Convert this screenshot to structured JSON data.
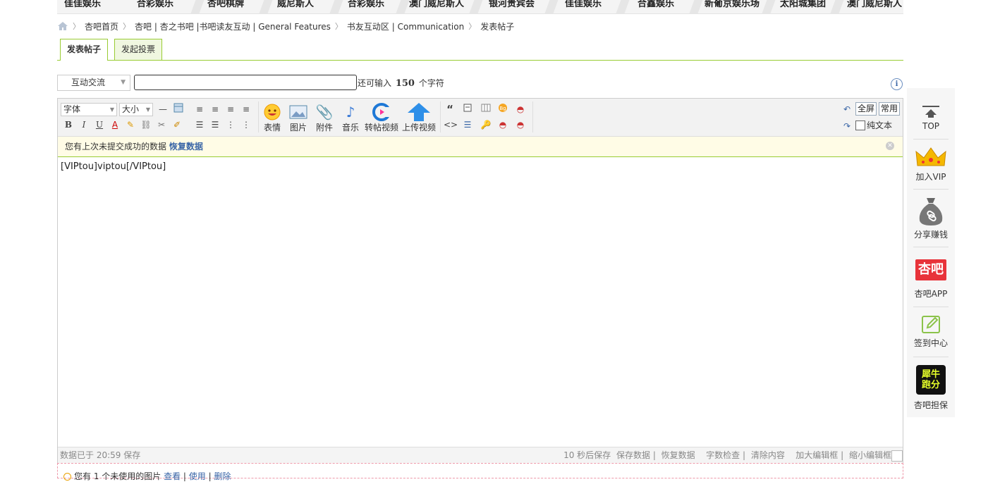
{
  "top_nav": [
    "佳佳娱乐",
    "合彩娱乐",
    "杏吧棋牌",
    "威尼斯人",
    "合彩娱乐",
    "澳门威尼斯人",
    "银河贵宾会",
    "佳佳娱乐",
    "合鑫娱乐",
    "新葡京娱乐场",
    "太阳城集团",
    "澳门威尼斯人"
  ],
  "breadcrumb": [
    "杏吧首页",
    "杏吧 | 杏之书吧 |书吧读友互动 | General Features",
    "书友互动区 | Communication",
    "发表帖子"
  ],
  "tabs": {
    "post": "发表帖子",
    "vote": "发起投票"
  },
  "category": "互动交流",
  "title_input": {
    "value": "",
    "placeholder": ""
  },
  "remain": {
    "prefix": "还可输入",
    "count": "150",
    "suffix": "个字符"
  },
  "info_icon": "i",
  "toolbar": {
    "font": "字体",
    "size": "大小",
    "emoji": "表情",
    "image": "图片",
    "attach": "附件",
    "music": "音乐",
    "repost_video": "转帖视频",
    "upload_video": "上传视频",
    "fullscreen": "全屏",
    "common": "常用",
    "plain_text": "纯文本",
    "fmt_bold": "B",
    "fmt_italic": "I",
    "fmt_underline": "U",
    "fmt_color": "A",
    "quote": "“",
    "code": "<>"
  },
  "notice": {
    "text": "您有上次未提交成功的数据",
    "link": "恢复数据"
  },
  "editor_content": "[VIPtou]viptou[/VIPtou]",
  "status": {
    "saved": "数据已于 20:59 保存",
    "autosave": "10 秒后保存",
    "save": "保存数据",
    "restore": "恢复数据",
    "wordcheck": "字数检查",
    "clear": "清除内容",
    "enlarge": "加大编辑框",
    "shrink": "缩小编辑框"
  },
  "unused_images": {
    "text": "您有 1 个未使用的图片",
    "view": "查看",
    "use": "使用",
    "delete": "删除"
  },
  "sidebar": {
    "top": "TOP",
    "vip": "加入VIP",
    "share": "分享赚钱",
    "app_logo": "杏吧",
    "app": "杏吧APP",
    "checkin": "签到中心",
    "badge": "犀牛跑分",
    "guarantee": "杏吧担保"
  },
  "colors": {
    "accent_green": "#99cc33",
    "link_blue": "#3a66a7",
    "app_red": "#e8333a"
  }
}
